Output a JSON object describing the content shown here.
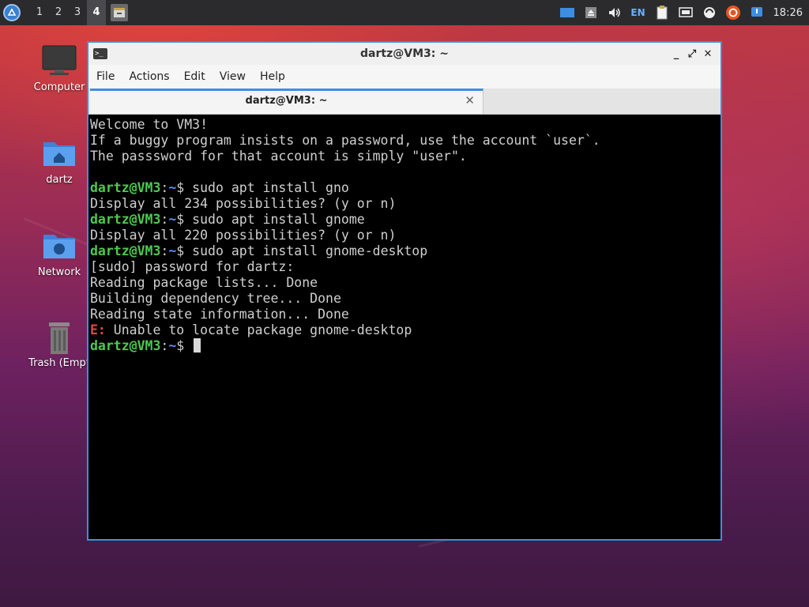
{
  "panel": {
    "workspaces": [
      "1",
      "2",
      "3",
      "4"
    ],
    "active_workspace": "4",
    "language": "EN",
    "clock": "18:26"
  },
  "desktop": {
    "icons": [
      {
        "label": "Computer",
        "icon": "monitor-icon"
      },
      {
        "label": "dartz",
        "icon": "home-folder-icon"
      },
      {
        "label": "Network",
        "icon": "network-folder-icon"
      },
      {
        "label": "Trash (Empt",
        "icon": "trash-icon"
      }
    ]
  },
  "window": {
    "title": "dartz@VM3: ~",
    "controls": [
      "_",
      "⤢",
      "✕"
    ],
    "menu": [
      "File",
      "Actions",
      "Edit",
      "View",
      "Help"
    ],
    "tab_title": "dartz@VM3: ~",
    "tab_close": "✕"
  },
  "terminal": {
    "prompt_user": "dartz@VM3",
    "prompt_path": "~",
    "lines": [
      {
        "type": "text",
        "text": "Welcome to VM3!"
      },
      {
        "type": "text",
        "text": "If a buggy program insists on a password, use the account `user`."
      },
      {
        "type": "text",
        "text": "The passsword for that account is simply \"user\"."
      },
      {
        "type": "text",
        "text": ""
      },
      {
        "type": "prompt",
        "text": " sudo apt install gno"
      },
      {
        "type": "text",
        "text": "Display all 234 possibilities? (y or n)"
      },
      {
        "type": "prompt",
        "text": " sudo apt install gnome"
      },
      {
        "type": "text",
        "text": "Display all 220 possibilities? (y or n)"
      },
      {
        "type": "prompt",
        "text": " sudo apt install gnome-desktop"
      },
      {
        "type": "text",
        "text": "[sudo] password for dartz:"
      },
      {
        "type": "text",
        "text": "Reading package lists... Done"
      },
      {
        "type": "text",
        "text": "Building dependency tree... Done"
      },
      {
        "type": "text",
        "text": "Reading state information... Done"
      },
      {
        "type": "error",
        "prefix": "E:",
        "text": " Unable to locate package gnome-desktop"
      },
      {
        "type": "prompt-cursor",
        "text": " "
      }
    ]
  },
  "colors": {
    "accent": "#3d8ee0",
    "prompt_user": "#4ec94e",
    "prompt_path": "#5a8cff",
    "error": "#e04848"
  }
}
